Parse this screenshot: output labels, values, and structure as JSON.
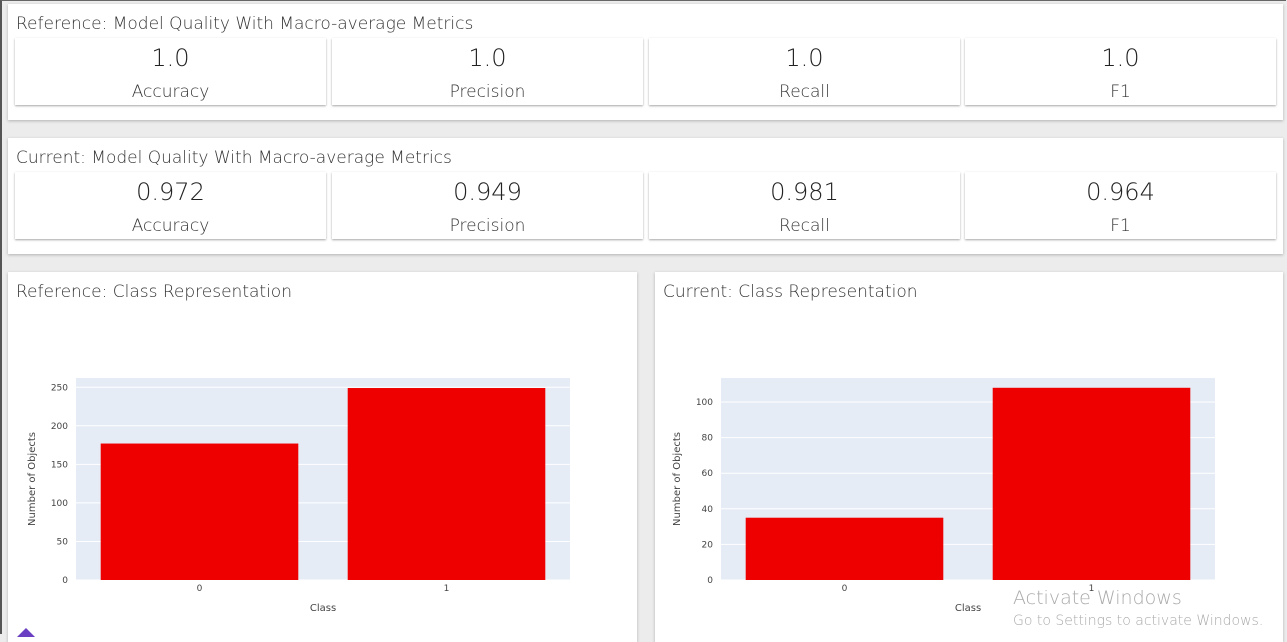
{
  "reference_quality": {
    "title": "Reference: Model Quality With Macro-average Metrics",
    "metrics": [
      {
        "value": "1.0",
        "label": "Accuracy"
      },
      {
        "value": "1.0",
        "label": "Precision"
      },
      {
        "value": "1.0",
        "label": "Recall"
      },
      {
        "value": "1.0",
        "label": "F1"
      }
    ]
  },
  "current_quality": {
    "title": "Current: Model Quality With Macro-average Metrics",
    "metrics": [
      {
        "value": "0.972",
        "label": "Accuracy"
      },
      {
        "value": "0.949",
        "label": "Precision"
      },
      {
        "value": "0.981",
        "label": "Recall"
      },
      {
        "value": "0.964",
        "label": "F1"
      }
    ]
  },
  "reference_class": {
    "title": "Reference: Class Representation"
  },
  "current_class": {
    "title": "Current: Class Representation"
  },
  "watermark": {
    "line1": "Activate Windows",
    "line2": "Go to Settings to activate Windows."
  },
  "colors": {
    "bar": "#ee0000",
    "plot_bg": "#e5ecf6",
    "grid": "#ffffff"
  },
  "chart_data": [
    {
      "type": "bar",
      "categories": [
        "0",
        "1"
      ],
      "values": [
        177,
        249
      ],
      "xlabel": "Class",
      "ylabel": "Number of Objects",
      "yticks": [
        0,
        50,
        100,
        150,
        200,
        250
      ],
      "ylim": [
        0,
        262
      ],
      "grid": true
    },
    {
      "type": "bar",
      "categories": [
        "0",
        "1"
      ],
      "values": [
        35,
        108
      ],
      "xlabel": "Class",
      "ylabel": "Number of Objects",
      "yticks": [
        0,
        20,
        40,
        60,
        80,
        100
      ],
      "ylim": [
        0,
        113.5
      ],
      "grid": true
    }
  ]
}
